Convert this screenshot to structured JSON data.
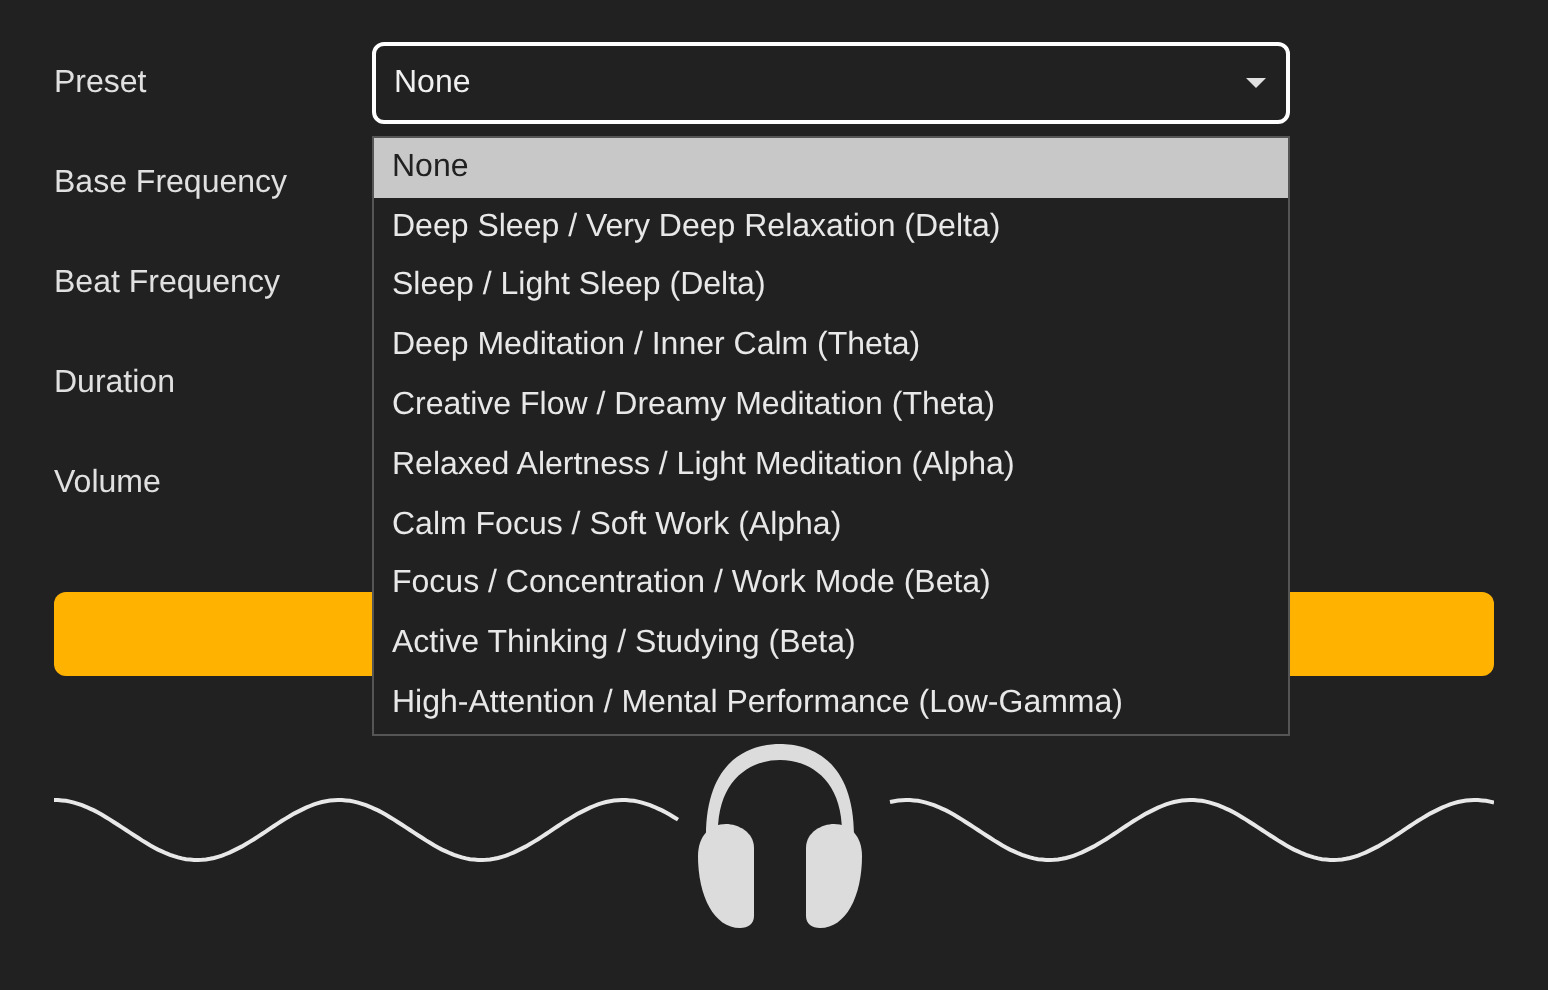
{
  "fields": [
    {
      "label": "Preset"
    },
    {
      "label": "Base Frequency"
    },
    {
      "label": "Beat Frequency"
    },
    {
      "label": "Duration"
    },
    {
      "label": "Volume"
    }
  ],
  "preset_select": {
    "value": "None",
    "expanded": true,
    "options": [
      {
        "label": "None",
        "selected": true
      },
      {
        "label": "Deep Sleep / Very Deep Relaxation (Delta)",
        "selected": false
      },
      {
        "label": "Sleep / Light Sleep (Delta)",
        "selected": false
      },
      {
        "label": "Deep Meditation / Inner Calm (Theta)",
        "selected": false
      },
      {
        "label": "Creative Flow / Dreamy Meditation (Theta)",
        "selected": false
      },
      {
        "label": "Relaxed Alertness / Light Meditation (Alpha)",
        "selected": false
      },
      {
        "label": "Calm Focus / Soft Work (Alpha)",
        "selected": false
      },
      {
        "label": "Focus / Concentration / Work Mode (Beta)",
        "selected": false
      },
      {
        "label": "Active Thinking / Studying (Beta)",
        "selected": false
      },
      {
        "label": "High-Attention / Mental Performance (Low-Gamma)",
        "selected": false
      }
    ]
  }
}
